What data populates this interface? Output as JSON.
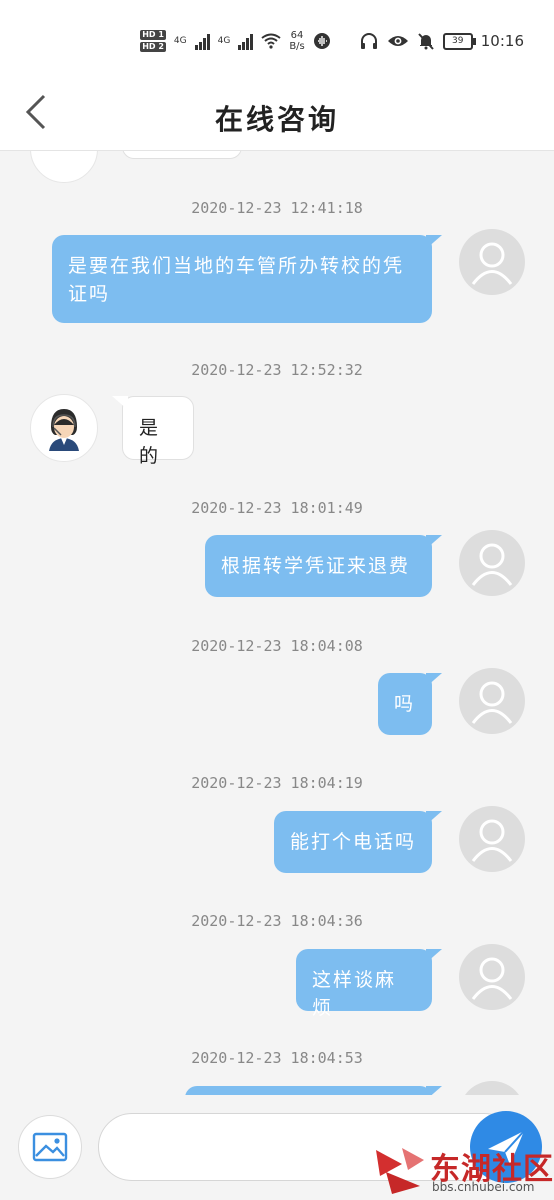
{
  "status_bar": {
    "sim1": "HD 1",
    "sim2": "HD 2",
    "net1": "4G",
    "net2": "4G",
    "speed_value": "64",
    "speed_unit": "B/s",
    "battery": "39",
    "time": "10:16"
  },
  "header": {
    "title": "在线咨询"
  },
  "messages": [
    {
      "time": "2020-12-23 12:41:18",
      "sender": "me",
      "text": "是要在我们当地的车管所办转校的凭证吗"
    },
    {
      "time": "2020-12-23 12:52:32",
      "sender": "them",
      "text": "是的"
    },
    {
      "time": "2020-12-23 18:01:49",
      "sender": "me",
      "text": "根据转学凭证来退费"
    },
    {
      "time": "2020-12-23 18:04:08",
      "sender": "me",
      "text": "吗"
    },
    {
      "time": "2020-12-23 18:04:19",
      "sender": "me",
      "text": "能打个电话吗"
    },
    {
      "time": "2020-12-23 18:04:36",
      "sender": "me",
      "text": "这样谈麻烦"
    },
    {
      "time": "2020-12-23 18:04:53",
      "sender": "me",
      "text": ""
    }
  ],
  "input": {
    "placeholder": ""
  },
  "watermark": {
    "name": "东湖社区",
    "url": "bbs.cnhubei.com"
  },
  "colors": {
    "my_bubble": "#7dbdf0",
    "their_bubble": "#ffffff",
    "send_button": "#2f8ae5",
    "watermark": "#c62828"
  },
  "icons": {
    "back": "chevron-left-icon",
    "image": "image-icon",
    "send": "paper-plane-icon",
    "user": "user-silhouette-icon",
    "agent": "customer-service-agent-icon"
  }
}
